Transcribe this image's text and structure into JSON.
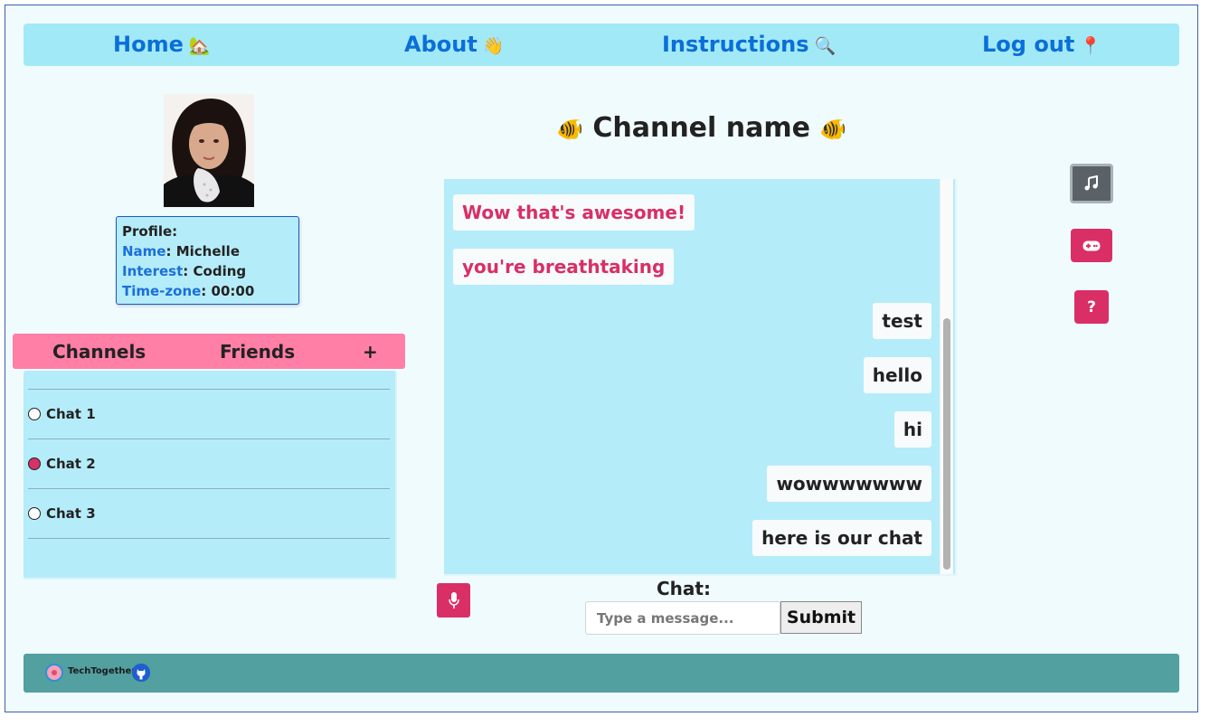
{
  "nav": {
    "items": [
      {
        "label": "Home",
        "emoji": "🏡"
      },
      {
        "label": "About",
        "emoji": "👋"
      },
      {
        "label": "Instructions",
        "emoji": "🔍"
      },
      {
        "label": "Log out",
        "emoji": "📍"
      }
    ]
  },
  "profile": {
    "heading": "Profile:",
    "name_key": "Name",
    "name": "Michelle",
    "interest_key": "Interest",
    "interest": "Coding",
    "timezone_key": "Time-zone",
    "timezone": "00:00"
  },
  "tabs": {
    "channels": "Channels",
    "friends": "Friends",
    "add": "+"
  },
  "channels": [
    {
      "label": "Chat 1",
      "selected": false
    },
    {
      "label": "Chat 2",
      "selected": true
    },
    {
      "label": "Chat 3",
      "selected": false
    }
  ],
  "channel_title": {
    "text": "Channel name",
    "emoji": "🐠"
  },
  "messages": [
    {
      "text": "Wow that's awesome!",
      "direction": "in"
    },
    {
      "text": "you're breathtaking",
      "direction": "in"
    },
    {
      "text": "test",
      "direction": "out"
    },
    {
      "text": "hello",
      "direction": "out"
    },
    {
      "text": "hi",
      "direction": "out"
    },
    {
      "text": "wowwwwwww",
      "direction": "out"
    },
    {
      "text": "here is our chat",
      "direction": "out"
    }
  ],
  "chat_input": {
    "label": "Chat:",
    "placeholder": "Type a message...",
    "value": "",
    "submit_label": "Submit"
  },
  "right_icons": [
    {
      "icon": "music-note-icon",
      "color": "#5a6268"
    },
    {
      "icon": "gamepad-icon",
      "color": "#d92f66"
    },
    {
      "icon": "question-icon",
      "color": "#d92f66"
    }
  ],
  "footer": {
    "brand": "TechTogether",
    "github_icon": "github-icon"
  },
  "colors": {
    "nav_bg": "#a2e9f8",
    "nav_text": "#0a6fd8",
    "tabs_bg": "#ff7fa6",
    "panel_bg": "#b5ecf9",
    "accent": "#d92f66",
    "footer_bg": "#52a0a0"
  }
}
